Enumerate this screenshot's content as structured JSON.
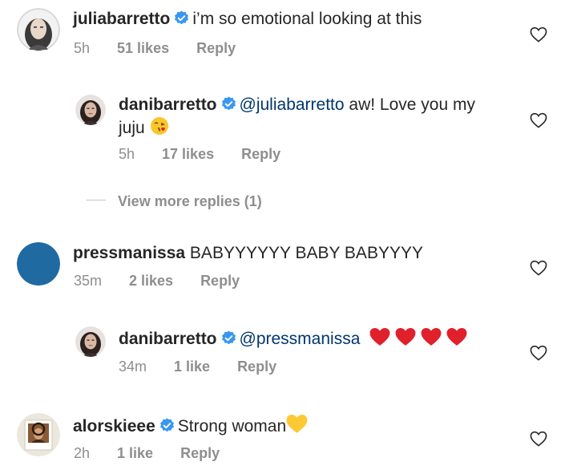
{
  "comments": [
    {
      "username": "juliabarretto",
      "verified": true,
      "text": "i’m so emotional looking at this",
      "time": "5h",
      "likes": "51 likes",
      "reply": "Reply"
    },
    {
      "username": "danibarretto",
      "verified": true,
      "mention": "@juliabarretto",
      "text_line1": " aw! Love you my",
      "text_line2": "juju",
      "emoji": "face-blowing-kiss-icon",
      "time": "5h",
      "likes": "17 likes",
      "reply": "Reply"
    },
    {
      "username": "pressmanissa",
      "verified": false,
      "text": " BABYYYYYY BABY BABYYYY",
      "time": "35m",
      "likes": "2 likes",
      "reply": "Reply"
    },
    {
      "username": "danibarretto",
      "verified": true,
      "mention": "@pressmanissa",
      "emoji": "red-heart-icon",
      "emoji_count": 4,
      "time": "34m",
      "likes": "1 like",
      "reply": "Reply"
    },
    {
      "username": "alorskieee",
      "verified": true,
      "text": "Strong woman",
      "emoji": "yellow-heart-icon",
      "time": "2h",
      "likes": "1 like",
      "reply": "Reply"
    }
  ],
  "view_more": "View more replies (1)",
  "colors": {
    "verified_blue": "#3897f0",
    "mention": "#00376b",
    "meta_gray": "#8e8e8e",
    "avatar_blue": "#1f6aa1",
    "red_heart": "#e0202b",
    "yellow_heart": "#fcc935"
  }
}
